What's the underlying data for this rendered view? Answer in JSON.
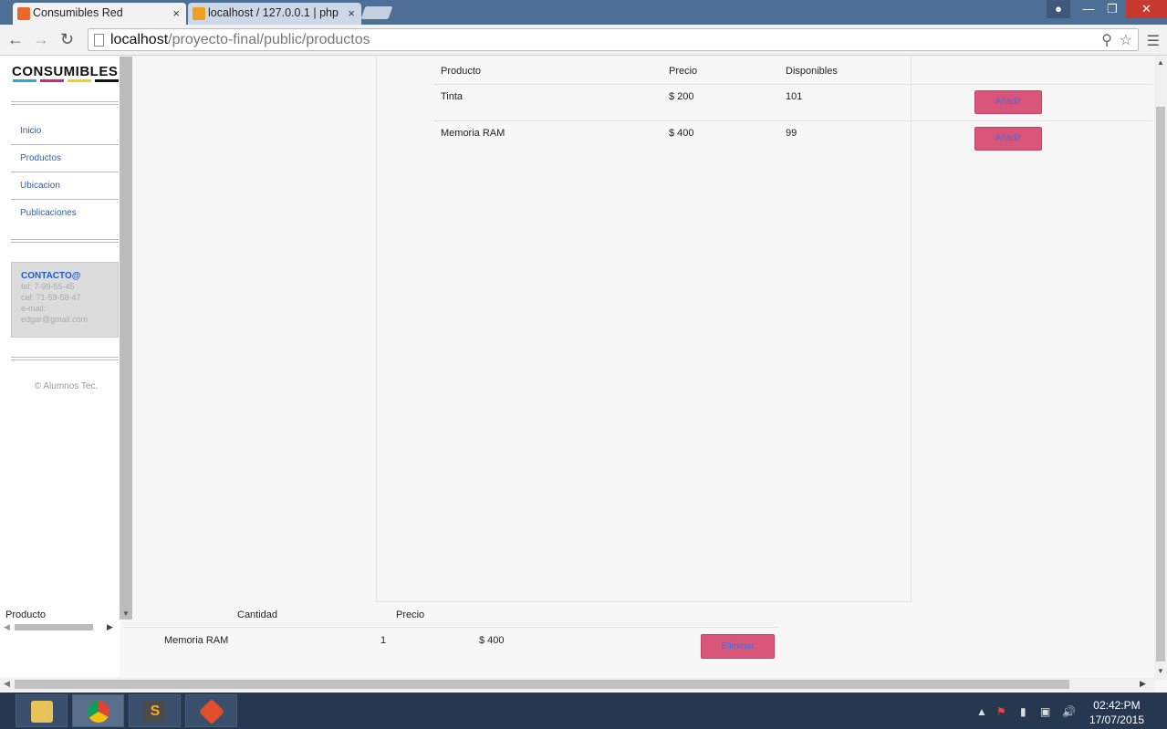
{
  "browser": {
    "tabs": [
      {
        "title": "Consumibles Red",
        "active": true
      },
      {
        "title": "localhost / 127.0.0.1 | php",
        "active": false
      }
    ],
    "tab_close_symbol": "×",
    "url_host": "localhost",
    "url_path": "/proyecto-final/public/productos"
  },
  "sidebar": {
    "logo": "CONSUMIBLES",
    "logo_colors": [
      "#2aa7e0",
      "#d6247e",
      "#f2d21b",
      "#111111"
    ],
    "nav": [
      "Inicio",
      "Productos",
      "Ubicacion",
      "Publicaciones"
    ],
    "contact": {
      "title": "CONTACTO@",
      "lines": [
        "tel: 7-99-55-45",
        "cel: 71-59-58-47",
        "e-mail:",
        "edgar@gmail.com"
      ]
    },
    "copyright": "© Alumnos Tec."
  },
  "products_table": {
    "headers": [
      "Producto",
      "Precio",
      "Disponibles"
    ],
    "rows": [
      {
        "producto": "Tinta",
        "precio": "$ 200",
        "disponibles": "101",
        "action": "Añadir"
      },
      {
        "producto": "Memoria RAM",
        "precio": "$ 400",
        "disponibles": "99",
        "action": "Añadir"
      }
    ]
  },
  "cart_table": {
    "headers": [
      "Producto",
      "Cantidad",
      "Precio"
    ],
    "rows": [
      {
        "producto": "Memoria RAM",
        "cantidad": "1",
        "precio": "$ 400",
        "action": "Eliminar"
      }
    ]
  },
  "taskbar": {
    "apps": [
      "file-explorer",
      "chrome",
      "sublime-text",
      "git"
    ],
    "time": "02:42:PM",
    "date": "17/07/2015"
  },
  "colors": {
    "accent_button": "#d9567a",
    "link": "#2b62b7",
    "contact_title": "#1f5bd0"
  }
}
